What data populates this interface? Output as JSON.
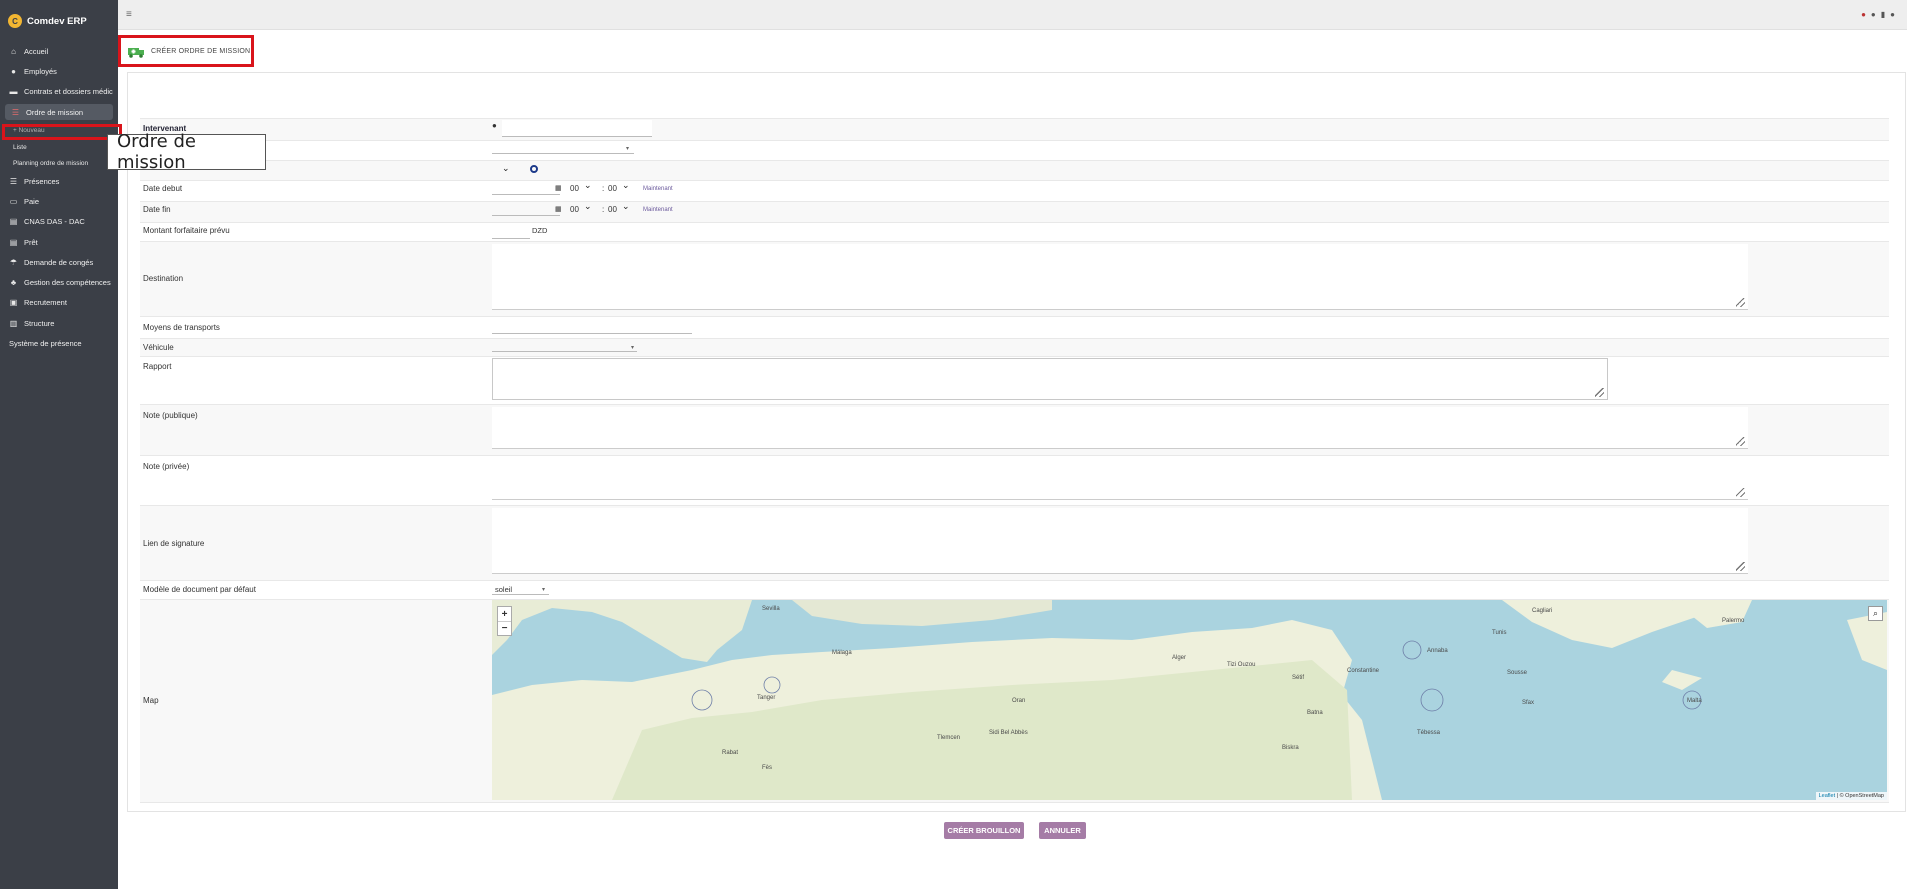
{
  "app": {
    "name": "Comdev ERP"
  },
  "sidebar": {
    "items": [
      {
        "label": "Accueil",
        "icon": "home-icon"
      },
      {
        "label": "Employés",
        "icon": "user-icon"
      },
      {
        "label": "Contrats et dossiers médic",
        "icon": "folder-icon"
      },
      {
        "label": "Ordre de mission",
        "icon": "list-icon"
      },
      {
        "label": "Présences",
        "icon": "list-icon"
      },
      {
        "label": "Paie",
        "icon": "money-icon"
      },
      {
        "label": "CNAS DAS - DAC",
        "icon": "document-icon"
      },
      {
        "label": "Prêt",
        "icon": "document-icon"
      },
      {
        "label": "Demande de congés",
        "icon": "umbrella-icon"
      },
      {
        "label": "Gestion des compétences",
        "icon": "skills-icon"
      },
      {
        "label": "Recrutement",
        "icon": "briefcase-icon"
      },
      {
        "label": "Structure",
        "icon": "building-icon"
      },
      {
        "label": "Système de présence",
        "icon": ""
      }
    ],
    "subitems": {
      "nouveau": "+ Nouveau",
      "liste": "Liste",
      "planning": "Planning ordre de mission"
    }
  },
  "page": {
    "title": "CRÉER ORDRE DE MISSION",
    "tooltip": "Ordre de mission"
  },
  "form": {
    "intervenant_label": "Intervenant",
    "date_debut_label": "Date debut",
    "date_fin_label": "Date fin",
    "montant_label": "Montant forfaitaire prévu",
    "currency": "DZD",
    "destination_label": "Destination",
    "moyens_label": "Moyens de transports",
    "vehicule_label": "Véhicule",
    "rapport_label": "Rapport",
    "note_publique_label": "Note (publique)",
    "note_privee_label": "Note (privée)",
    "lien_signature_label": "Lien de signature",
    "modele_label": "Modèle de document par défaut",
    "modele_value": "soleil",
    "map_label": "Map",
    "time_hour": "00",
    "time_min": "00",
    "time_sep": ":",
    "now_label": "Maintenant"
  },
  "map": {
    "labels": [
      "Sevilla",
      "Málaga",
      "Tanger",
      "Oran",
      "Alger",
      "Tizi Ouzou",
      "Sidi Bel Abbès",
      "Tlemcen",
      "Sétif",
      "Constantine",
      "Annaba",
      "Tunis",
      "Sousse",
      "Sfax",
      "Palermo",
      "Malta",
      "Batna",
      "Biskra",
      "Fès",
      "Rabat",
      "Tébessa",
      "Cagliari"
    ],
    "attribution_leaflet": "Leaflet",
    "attribution_osm": "| © OpenStreetMap"
  },
  "buttons": {
    "create_draft": "CRÉER BROUILLON",
    "cancel": "ANNULER"
  }
}
